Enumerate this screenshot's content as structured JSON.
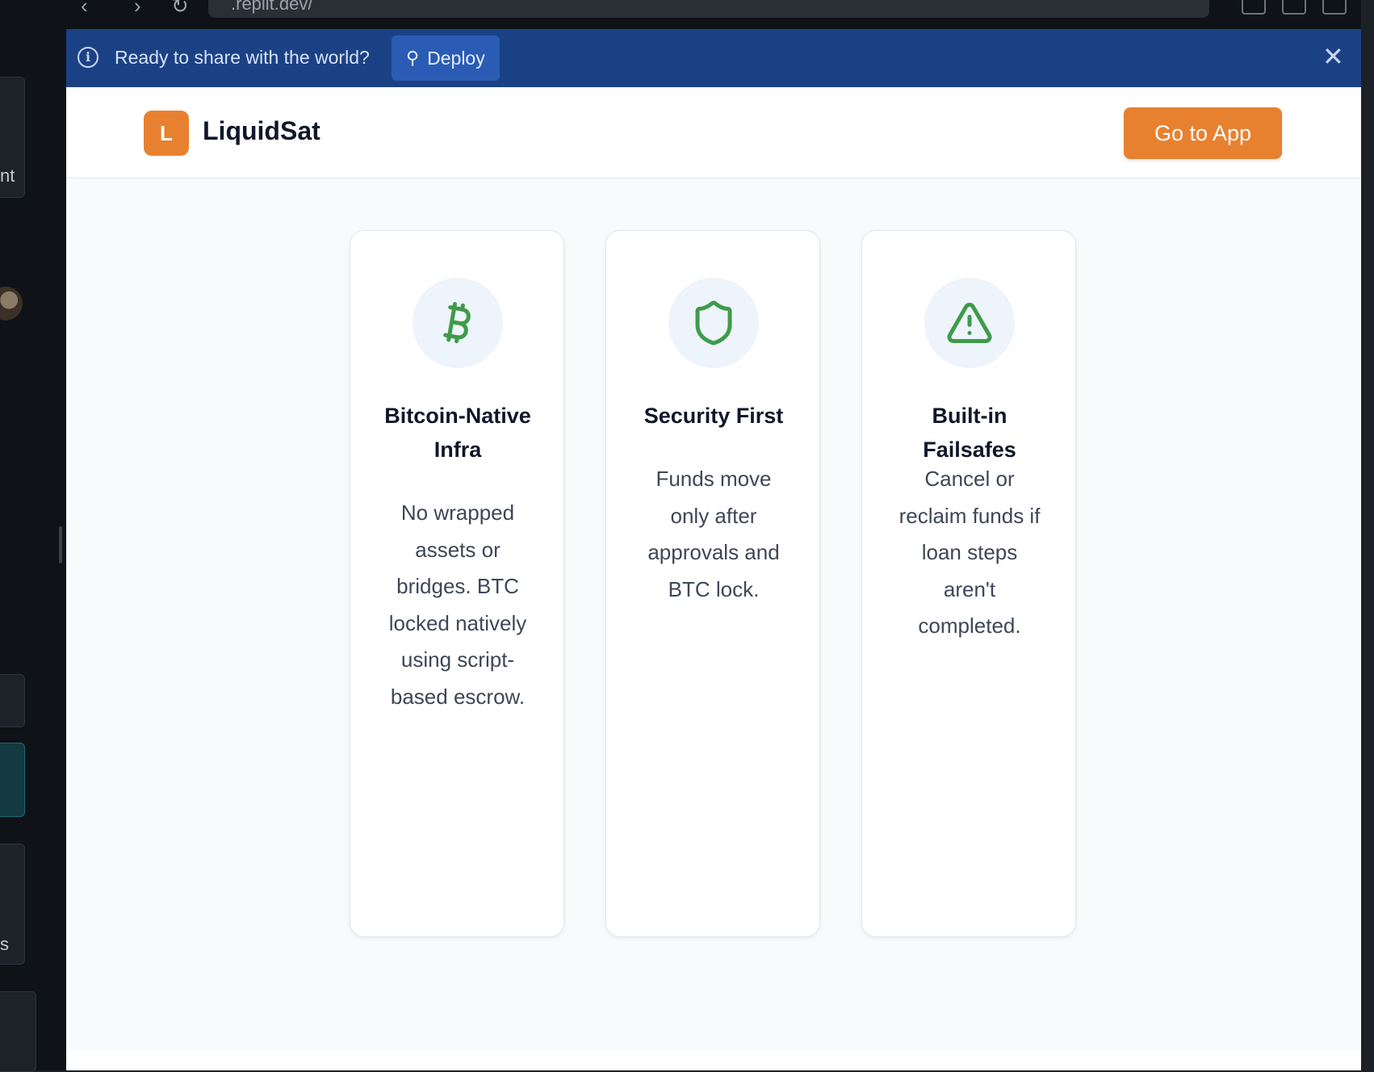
{
  "browser": {
    "url": ".replit.dev/"
  },
  "left_sidebar": {
    "fragments": [
      "nt",
      "s"
    ]
  },
  "banner": {
    "message": "Ready to share with the world?",
    "deploy_label": "Deploy"
  },
  "header": {
    "logo_letter": "L",
    "brand": "LiquidSat",
    "cta_label": "Go to App"
  },
  "features": [
    {
      "icon": "bitcoin-icon",
      "title": "Bitcoin-Native Infra",
      "description": "No wrapped assets or bridges. BTC locked natively using script-based escrow."
    },
    {
      "icon": "shield-icon",
      "title": "Security First",
      "description": "Funds move only after approvals and BTC lock."
    },
    {
      "icon": "warning-icon",
      "title": "Built-in Failsafes",
      "description": "Cancel or reclaim funds if loan steps aren't completed."
    }
  ],
  "colors": {
    "accent": "#e8812f",
    "banner": "#1b4185",
    "icon_green": "#3f9b4a"
  }
}
